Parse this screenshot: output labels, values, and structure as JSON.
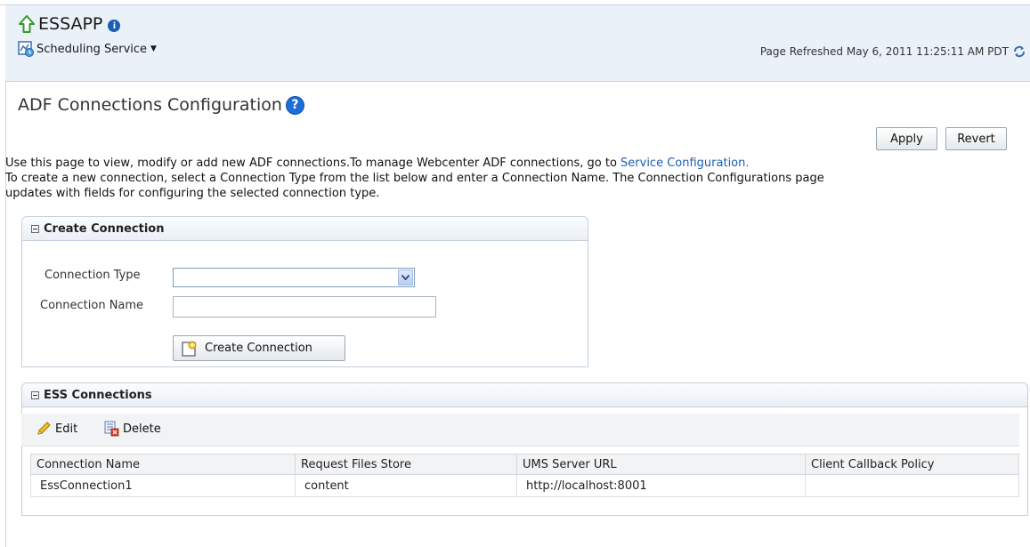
{
  "app": {
    "title": "ESSAPP",
    "info_glyph": "i"
  },
  "menu": {
    "label": "Scheduling Service"
  },
  "status": {
    "refreshed": "Page Refreshed May 6, 2011 11:25:11 AM PDT"
  },
  "page": {
    "title": "ADF Connections Configuration",
    "help_glyph": "?"
  },
  "actions": {
    "apply": "Apply",
    "revert": "Revert"
  },
  "description": {
    "line1": "Use this page to view, modify or add new ADF connections.To manage Webcenter ADF connections, go to ",
    "link": "Service Configuration.",
    "line2": "To create a new connection, select a Connection Type from the list below and enter a Connection Name. The Connection Configurations page",
    "line3": "updates with fields for configuring the selected connection type."
  },
  "create_panel": {
    "title": "Create Connection",
    "type_label": "Connection Type",
    "type_value": "",
    "name_label": "Connection Name",
    "name_value": "",
    "button": "Create Connection"
  },
  "ess_panel": {
    "title": "ESS Connections",
    "edit": "Edit",
    "delete": "Delete",
    "columns": [
      "Connection Name",
      "Request Files Store",
      "UMS Server URL",
      "Client Callback Policy"
    ],
    "rows": [
      [
        "EssConnection1",
        "content",
        "http://localhost:8001",
        ""
      ]
    ]
  },
  "colors": {
    "header_bg": "#eaf1f8",
    "link": "#1a5fb4",
    "panel_border": "#c3cfdb"
  }
}
